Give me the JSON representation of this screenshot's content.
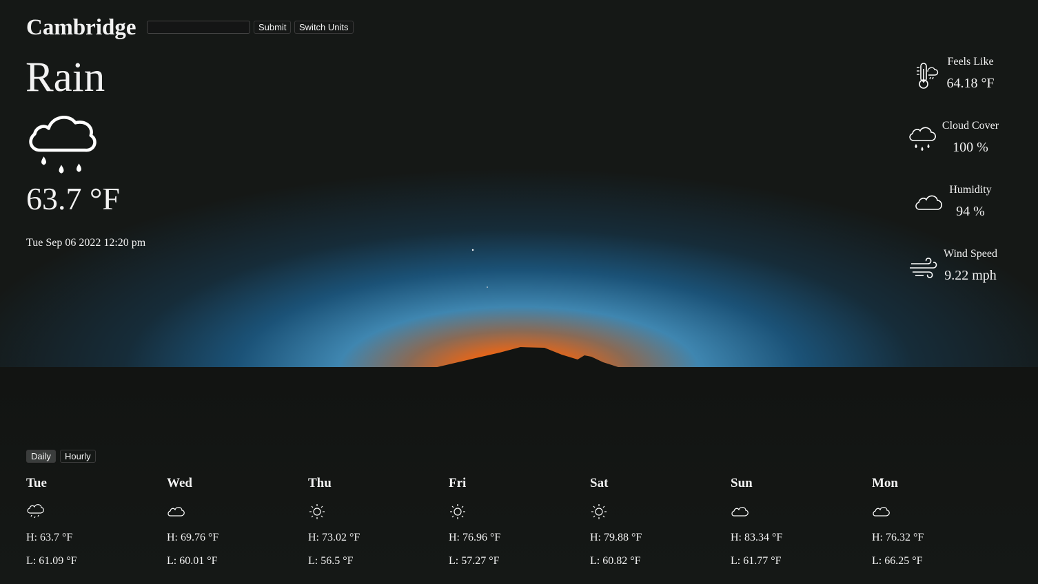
{
  "header": {
    "city": "Cambridge",
    "search_value": "",
    "submit_label": "Submit",
    "switch_units_label": "Switch Units"
  },
  "current": {
    "condition": "Rain",
    "icon": "cloud-rain-icon",
    "temperature": "63.7 °F",
    "datetime": "Tue Sep 06 2022 12:20 pm"
  },
  "stats": [
    {
      "label": "Feels Like",
      "value": "64.18 °F",
      "icon": "thermometer-icon"
    },
    {
      "label": "Cloud Cover",
      "value": "100 %",
      "icon": "cloud-rain-icon"
    },
    {
      "label": "Humidity",
      "value": "94 %",
      "icon": "cloud-icon"
    },
    {
      "label": "Wind Speed",
      "value": "9.22 mph",
      "icon": "wind-icon"
    }
  ],
  "forecast_tabs": {
    "daily": "Daily",
    "hourly": "Hourly",
    "active": "Daily"
  },
  "forecast": [
    {
      "day": "Tue",
      "icon": "cloud-rain-icon",
      "high": "H: 63.7 °F",
      "low": "L: 61.09 °F"
    },
    {
      "day": "Wed",
      "icon": "cloud-icon",
      "high": "H: 69.76 °F",
      "low": "L: 60.01 °F"
    },
    {
      "day": "Thu",
      "icon": "sun-icon",
      "high": "H: 73.02 °F",
      "low": "L: 56.5 °F"
    },
    {
      "day": "Fri",
      "icon": "sun-icon",
      "high": "H: 76.96 °F",
      "low": "L: 57.27 °F"
    },
    {
      "day": "Sat",
      "icon": "sun-icon",
      "high": "H: 79.88 °F",
      "low": "L: 60.82 °F"
    },
    {
      "day": "Sun",
      "icon": "cloud-icon",
      "high": "H: 83.34 °F",
      "low": "L: 61.77 °F"
    },
    {
      "day": "Mon",
      "icon": "cloud-icon",
      "high": "H: 76.32 °F",
      "low": "L: 66.25 °F"
    }
  ],
  "colors": {
    "background": "#151816",
    "horizon_orange": "#e8650e",
    "sky_blue": "#1e6a95",
    "text": "#f2f2f2"
  }
}
